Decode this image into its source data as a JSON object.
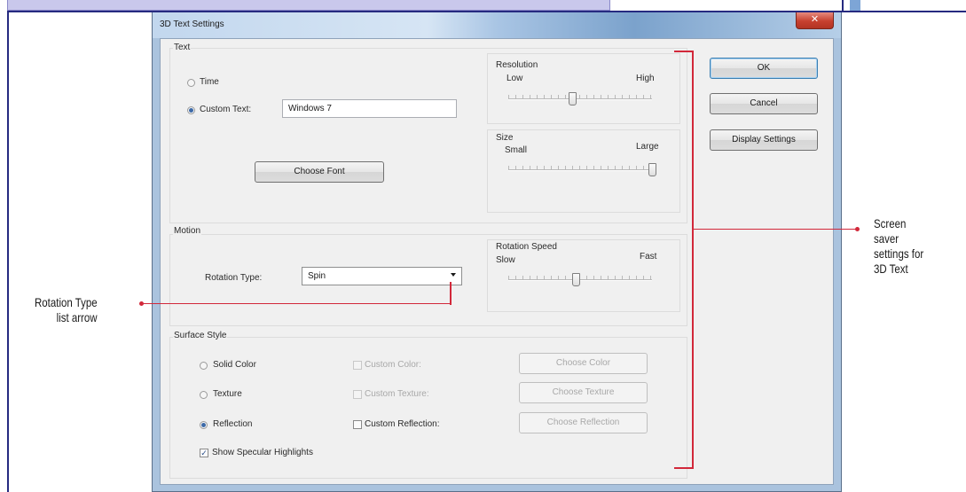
{
  "dialog": {
    "title": "3D Text Settings",
    "close_glyph": "✕"
  },
  "text_group": {
    "label": "Text",
    "radio_time": "Time",
    "radio_custom": "Custom Text:",
    "custom_text_value": "Windows 7",
    "choose_font": "Choose Font",
    "selected": "custom"
  },
  "resolution": {
    "label": "Resolution",
    "min_label": "Low",
    "max_label": "High",
    "value_fraction": 0.45
  },
  "size": {
    "label": "Size",
    "min_label": "Small",
    "max_label": "Large",
    "value_fraction": 1.0
  },
  "motion": {
    "label": "Motion",
    "rotation_type_label": "Rotation Type:",
    "rotation_type_value": "Spin"
  },
  "rotation_speed": {
    "label": "Rotation Speed",
    "min_label": "Slow",
    "max_label": "Fast",
    "value_fraction": 0.47
  },
  "surface_style": {
    "label": "Surface Style",
    "radio_solid": "Solid Color",
    "radio_texture": "Texture",
    "radio_reflection": "Reflection",
    "check_custom_color": "Custom Color:",
    "check_custom_texture": "Custom Texture:",
    "check_custom_reflection": "Custom Reflection:",
    "btn_choose_color": "Choose Color",
    "btn_choose_texture": "Choose Texture",
    "btn_choose_reflection": "Choose Reflection",
    "check_specular": "Show Specular Highlights",
    "selected": "reflection",
    "specular_checked": true
  },
  "side_buttons": {
    "ok": "OK",
    "cancel": "Cancel",
    "display_settings": "Display Settings"
  },
  "callouts": {
    "rotation_type_arrow_line1": "Rotation Type",
    "rotation_type_arrow_line2": "list arrow",
    "settings_line1": "Screen",
    "settings_line2": "saver",
    "settings_line3": "settings for",
    "settings_line4": "3D Text"
  },
  "colors": {
    "callout_red": "#d2283a",
    "frame_navy": "#262a80",
    "radio_selected": "#3d6aa8"
  }
}
